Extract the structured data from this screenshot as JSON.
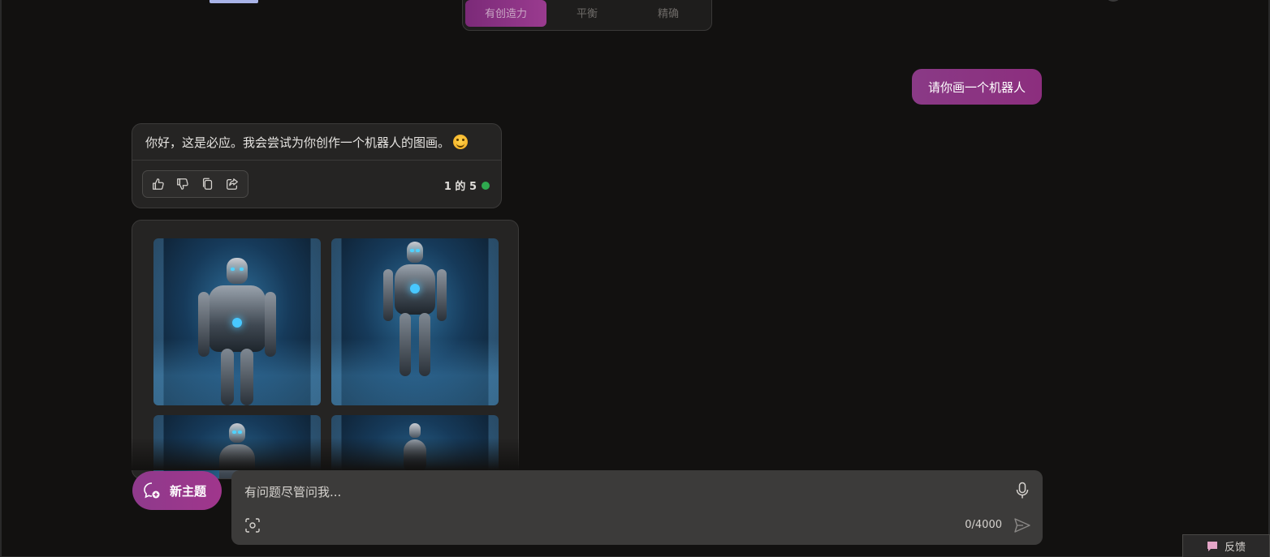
{
  "style_selector": {
    "options": [
      "有创造力",
      "平衡",
      "精确"
    ],
    "active_index": 0
  },
  "conversation": {
    "user_message": "请你画一个机器人",
    "bot_reply": "你好，这是必应。我会尝试为你创作一个机器人的图画。",
    "bot_reply_emoji": "smiling-face-icon",
    "counter": "1 的 5",
    "counter_status_color": "#2fa84f",
    "actions": [
      "like-icon",
      "dislike-icon",
      "copy-icon",
      "share-icon"
    ]
  },
  "images": {
    "count_visible": 4
  },
  "composer": {
    "new_topic_label": "新主题",
    "placeholder": "有问题尽管问我...",
    "char_count": "0/4000"
  },
  "feedback": {
    "label": "反馈"
  },
  "colors": {
    "accent": "#8f3a8c",
    "background": "#121110"
  }
}
